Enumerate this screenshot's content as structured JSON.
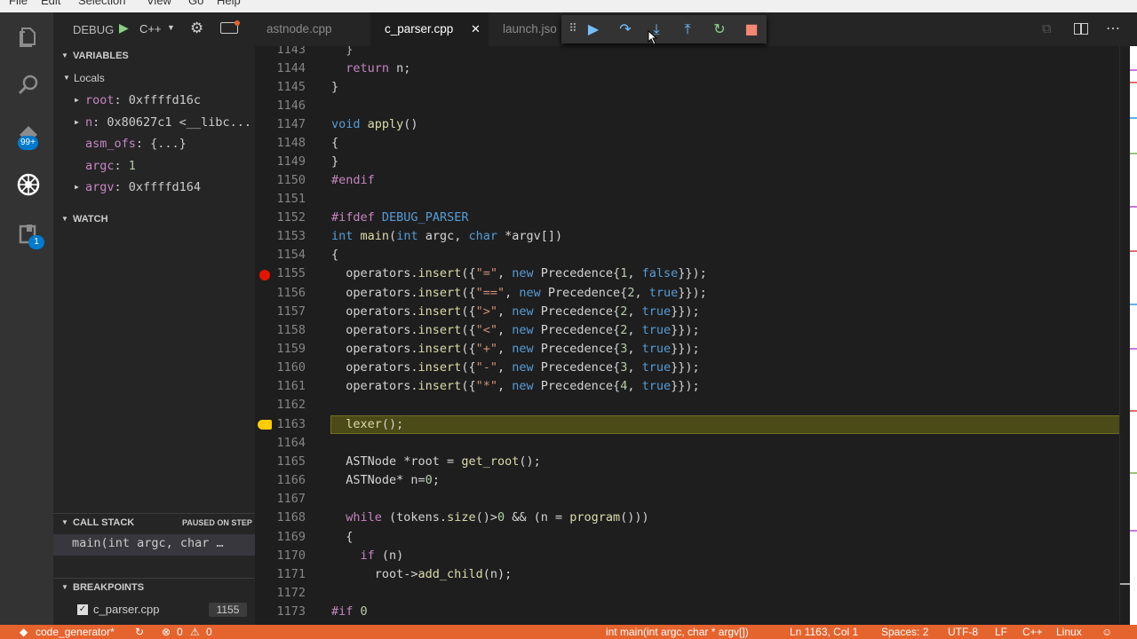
{
  "menu": [
    "File",
    "Edit",
    "Selection",
    "View",
    "Go",
    "Help"
  ],
  "activity": {
    "badges": [
      "99+",
      "1"
    ]
  },
  "debug_toolbar": {
    "label": "DEBUG",
    "config": "C++"
  },
  "variables": {
    "title": "VARIABLES",
    "locals_label": "Locals",
    "items": [
      {
        "name": "root",
        "sep": ": ",
        "value": "0xffffd16c",
        "expandable": true
      },
      {
        "name": "n",
        "sep": ": ",
        "value": "0x80627c1 <__libc...",
        "expandable": true
      },
      {
        "name": "asm_ofs",
        "sep": ": ",
        "value": "{...}",
        "expandable": false
      },
      {
        "name": "argc",
        "sep": ": ",
        "value": "1",
        "expandable": false
      },
      {
        "name": "argv",
        "sep": ": ",
        "value": "0xffffd164",
        "expandable": true
      }
    ]
  },
  "watch": {
    "title": "WATCH"
  },
  "callstack": {
    "title": "CALL STACK",
    "status": "PAUSED ON STEP",
    "frame": "main(int argc, char …"
  },
  "breakpoints": {
    "title": "BREAKPOINTS",
    "file": "c_parser.cpp",
    "line": "1155"
  },
  "tabs": [
    {
      "label": "astnode.cpp",
      "active": false
    },
    {
      "label": "c_parser.cpp",
      "active": true,
      "close": "✕"
    },
    {
      "label": "launch.jso",
      "active": false
    }
  ],
  "editor": {
    "line_numbers": [
      "1143",
      "1144",
      "1145",
      "1146",
      "1147",
      "1148",
      "1149",
      "1150",
      "1151",
      "1152",
      "1153",
      "1154",
      "1155",
      "1156",
      "1157",
      "1158",
      "1159",
      "1160",
      "1161",
      "1162",
      "1163",
      "1164",
      "1165",
      "1166",
      "1167",
      "1168",
      "1169",
      "1170",
      "1171",
      "1172",
      "1173"
    ],
    "breakpoint_line": "1155",
    "current_line": "1163"
  },
  "status": {
    "branch": "code_generator*",
    "errors": "0",
    "warnings": "0",
    "function": "int main(int argc, char * argv[])",
    "position": "Ln 1163, Col 1",
    "spaces": "Spaces: 2",
    "encoding": "UTF-8",
    "eol": "LF",
    "language": "C++",
    "os": "Linux"
  },
  "colors": {
    "status_bar": "#e5632d",
    "accent": "#007acc",
    "breakpoint": "#e51400",
    "current_line": "#ffcc00"
  }
}
